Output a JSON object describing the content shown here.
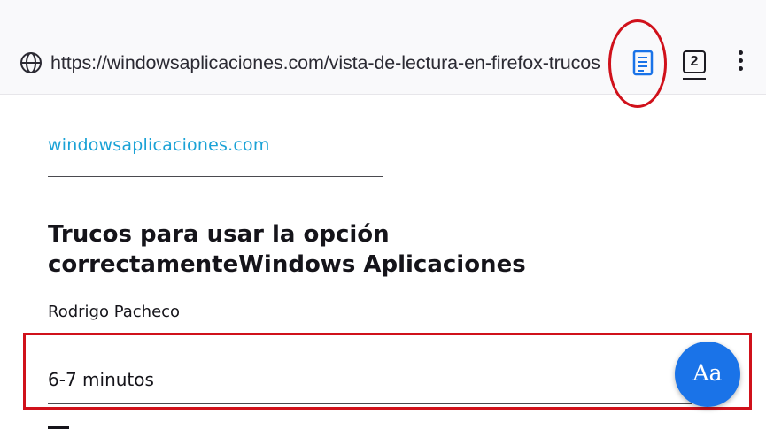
{
  "browser": {
    "url": "https://windowsaplicaciones.com/vista-de-lectura-en-firefox-trucos",
    "tab_count": "2",
    "reader_mode_icon": "reader-view-icon",
    "site_info_icon": "globe-icon",
    "menu_icon": "kebab-menu-icon",
    "reader_icon_color": "#1a73e8",
    "annotation_color": "#d0111b"
  },
  "article": {
    "site": "windowsaplicaciones.com",
    "title": "Trucos para usar la opción correctamenteWindows Aplicaciones",
    "author": "Rodrigo Pacheco",
    "read_time": "6-7 minutos"
  },
  "reader_controls": {
    "font_button_label": "Aa"
  }
}
